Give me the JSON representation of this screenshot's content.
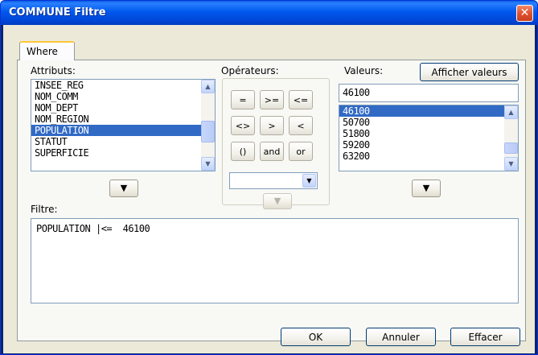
{
  "window": {
    "title": "COMMUNE Filtre",
    "close_glyph": "✕"
  },
  "tabs": [
    {
      "label": "Where",
      "active": true
    }
  ],
  "attributs": {
    "label": "Attributs:",
    "items": [
      "INSEE_REG",
      "NOM_COMM",
      "NOM_DEPT",
      "NOM_REGION",
      "POPULATION",
      "STATUT",
      "SUPERFICIE"
    ],
    "selected": "POPULATION",
    "insert_arrow": "▼"
  },
  "operateurs": {
    "label": "Opérateurs:",
    "buttons": [
      "=",
      ">=",
      "<=",
      "<>",
      ">",
      "<",
      "()",
      "and",
      "or"
    ],
    "combo_value": "",
    "insert_arrow": "▼"
  },
  "valeurs": {
    "label": "Valeurs:",
    "show_button": "Afficher valeurs",
    "input_value": "46100",
    "items": [
      "46100",
      "50700",
      "51800",
      "59200",
      "63200"
    ],
    "selected": "46100",
    "insert_arrow": "▼"
  },
  "filtre": {
    "label": "Filtre:",
    "expression": "POPULATION |<=  46100"
  },
  "footer": {
    "ok": "OK",
    "cancel": "Annuler",
    "clear": "Effacer"
  },
  "icons": {
    "scroll_up": "▲",
    "scroll_down": "▼",
    "combo_dropdown": "▼"
  }
}
